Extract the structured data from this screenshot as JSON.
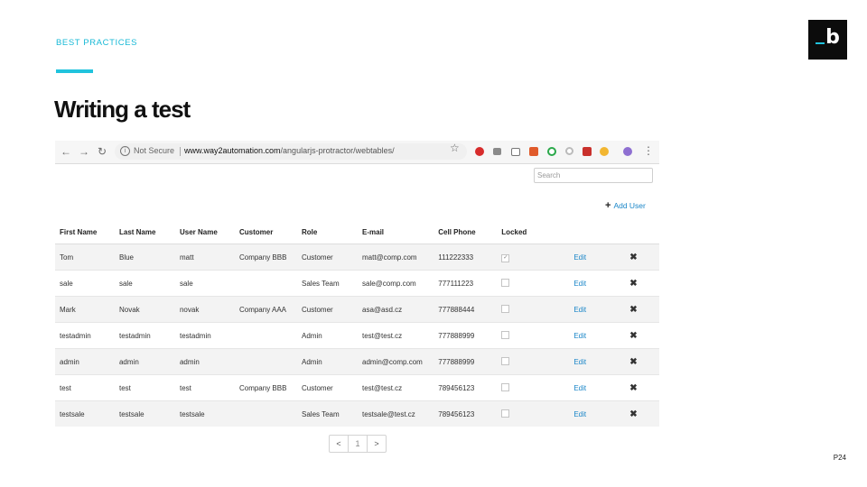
{
  "slide": {
    "section_label": "BEST PRACTICES",
    "title": "Writing a test",
    "logo_text": "b",
    "page_number": "P24",
    "accent_color": "#20c3dd"
  },
  "browser": {
    "back_icon": "back-arrow-icon",
    "forward_icon": "forward-arrow-icon",
    "reload_icon": "reload-icon",
    "security_label": "Not Secure",
    "url_domain": "www.way2automation.com",
    "url_path": "/angularjs-protractor/webtables/",
    "bookmark_icon": "star-icon",
    "menu_icon": "more-vert-icon"
  },
  "page": {
    "search_placeholder": "Search",
    "add_user_label": "Add User",
    "columns": [
      "First Name",
      "Last Name",
      "User Name",
      "Customer",
      "Role",
      "E-mail",
      "Cell Phone",
      "Locked",
      "",
      ""
    ],
    "edit_label": "Edit",
    "delete_icon": "✖",
    "rows": [
      {
        "first": "Tom",
        "last": "Blue",
        "user": "matt",
        "customer": "Company BBB",
        "role": "Customer",
        "email": "matt@comp.com",
        "phone": "111222333",
        "locked": true
      },
      {
        "first": "sale",
        "last": "sale",
        "user": "sale",
        "customer": "",
        "role": "Sales Team",
        "email": "sale@comp.com",
        "phone": "777111223",
        "locked": false
      },
      {
        "first": "Mark",
        "last": "Novak",
        "user": "novak",
        "customer": "Company AAA",
        "role": "Customer",
        "email": "asa@asd.cz",
        "phone": "777888444",
        "locked": false
      },
      {
        "first": "testadmin",
        "last": "testadmin",
        "user": "testadmin",
        "customer": "",
        "role": "Admin",
        "email": "test@test.cz",
        "phone": "777888999",
        "locked": false
      },
      {
        "first": "admin",
        "last": "admin",
        "user": "admin",
        "customer": "",
        "role": "Admin",
        "email": "admin@comp.com",
        "phone": "777888999",
        "locked": false
      },
      {
        "first": "test",
        "last": "test",
        "user": "test",
        "customer": "Company BBB",
        "role": "Customer",
        "email": "test@test.cz",
        "phone": "789456123",
        "locked": false
      },
      {
        "first": "testsale",
        "last": "testsale",
        "user": "testsale",
        "customer": "",
        "role": "Sales Team",
        "email": "testsale@test.cz",
        "phone": "789456123",
        "locked": false
      }
    ],
    "pagination": {
      "prev": "<",
      "current": "1",
      "next": ">"
    }
  }
}
